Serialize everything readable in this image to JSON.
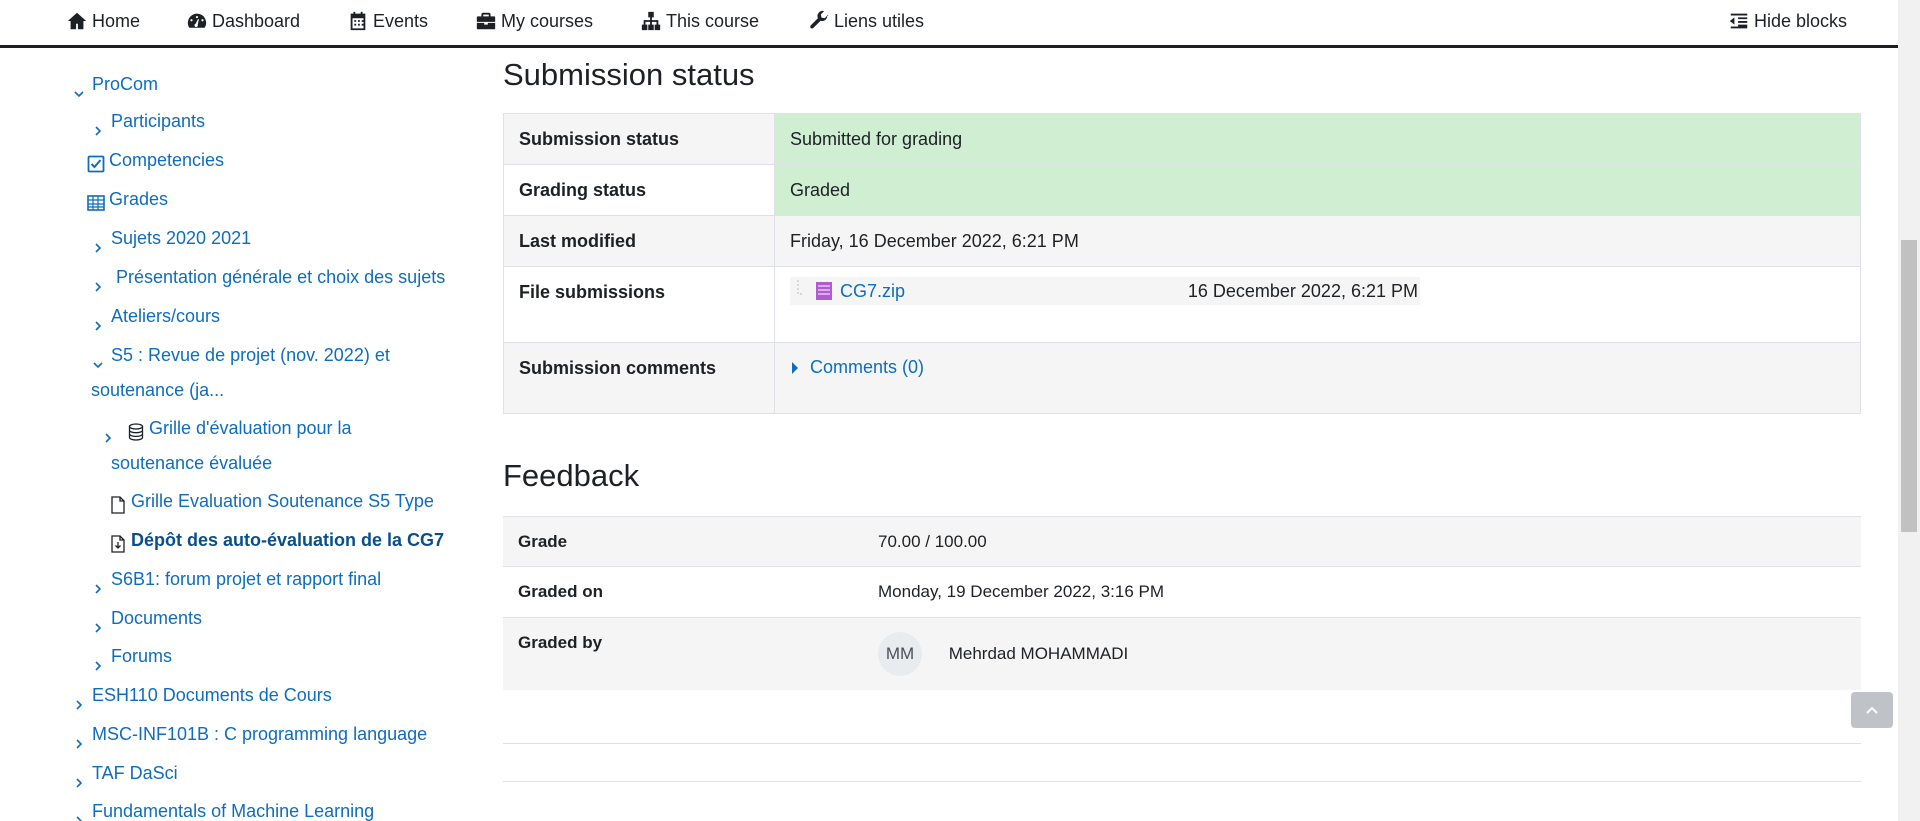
{
  "nav": {
    "home": "Home",
    "dashboard": "Dashboard",
    "events": "Events",
    "my_courses": "My courses",
    "this_course": "This course",
    "useful_links": "Liens utiles",
    "hide_blocks": "Hide blocks"
  },
  "drawer": {
    "procom": "ProCom",
    "participants": "Participants",
    "competencies": "Competencies",
    "grades": "Grades",
    "sujets": "Sujets 2020 2021",
    "presentation": "Présentation générale et choix des sujets",
    "ateliers": "Ateliers/cours",
    "s5_line1": "S5 : Revue de projet (nov. 2022) et",
    "s5_line2": "soutenance (ja...",
    "grille_line1": "Grille d'évaluation pour la",
    "grille_line2": "soutenance évaluée",
    "grille_type": "Grille Evaluation Soutenance S5 Type",
    "depot": "Dépôt des auto-évaluation de la CG7",
    "s6b1": "S6B1: forum projet et rapport final",
    "documents": "Documents",
    "forums": "Forums",
    "esh110": "ESH110 Documents de Cours",
    "msc": "MSC-INF101B : C programming language",
    "taf": "TAF DaSci",
    "fml": "Fundamentals of Machine Learning"
  },
  "submission": {
    "heading": "Submission status",
    "rows": {
      "status_label": "Submission status",
      "status_value": "Submitted for grading",
      "grading_label": "Grading status",
      "grading_value": "Graded",
      "modified_label": "Last modified",
      "modified_value": "Friday, 16 December 2022, 6:21 PM",
      "files_label": "File submissions",
      "file_name": "CG7.zip",
      "file_date": "16 December 2022, 6:21 PM",
      "comments_label": "Submission comments",
      "comments_link": "Comments (0)"
    }
  },
  "feedback": {
    "heading": "Feedback",
    "grade_label": "Grade",
    "grade_value": "70.00 / 100.00",
    "graded_on_label": "Graded on",
    "graded_on_value": "Monday, 19 December 2022, 3:16 PM",
    "graded_by_label": "Graded by",
    "grader_initials": "MM",
    "grader_name": "Mehrdad MOHAMMADI"
  },
  "colors": {
    "link": "#0f6cbf",
    "success_bg": "#d0efd2"
  }
}
